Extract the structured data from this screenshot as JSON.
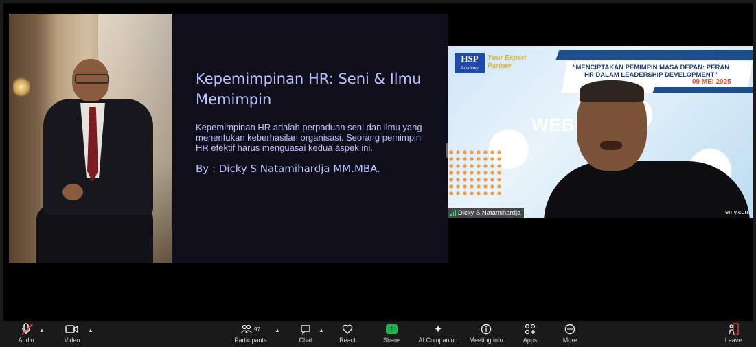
{
  "slide": {
    "title": "Kepemimpinan HR: Seni & Ilmu Memimpin",
    "body": "Kepemimpinan HR adalah perpaduan seni dan ilmu yang menentukan keberhasilan organisasi. Seorang pemimpin HR efektif harus menguasai kedua aspek ini.",
    "author": "By : Dicky S Natamihardja MM.MBA."
  },
  "video_tile": {
    "logo": "HSP",
    "logo_sub": "Academy",
    "tagline": "Your Expert Partner",
    "banner_title": "\"MENCIPTAKAN PEMIMPIN MASA DEPAN: PERAN HR DALAM LEADERSHIP DEVELOPMENT\"",
    "banner_date": "09 MEI 2025",
    "background_word": "WEBI",
    "url_fragment": "emy.com",
    "participant_name": "Dicky S.Natamihardja"
  },
  "toolbar": {
    "audio": "Audio",
    "video": "Video",
    "participants": "Participants",
    "participants_count": "97",
    "chat": "Chat",
    "react": "React",
    "share": "Share",
    "ai_companion": "AI Companion",
    "meeting_info": "Meeting info",
    "apps": "Apps",
    "more": "More",
    "leave": "Leave"
  },
  "colors": {
    "slide_text": "#b9c4ff",
    "share_green": "#22b14c",
    "leave_red": "#e03b3b",
    "mute_red": "#e03b3b"
  },
  "icons": [
    "microphone-muted-icon",
    "camera-icon",
    "participants-icon",
    "chat-icon",
    "heart-icon",
    "share-screen-icon",
    "sparkle-icon",
    "info-icon",
    "apps-icon",
    "more-icon",
    "leave-icon",
    "signal-icon"
  ]
}
